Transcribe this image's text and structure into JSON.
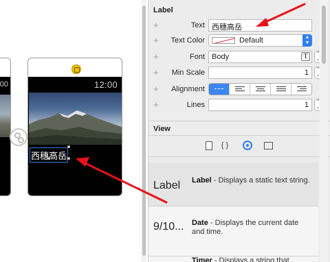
{
  "canvas": {
    "left_scene_time_fragment": "00",
    "main_scene": {
      "time": "12:00",
      "label_text": "西穗高岳"
    }
  },
  "inspector": {
    "label_section": {
      "title": "Label",
      "rows": {
        "text": {
          "label": "Text",
          "value": "西穗高岳"
        },
        "text_color": {
          "label": "Text Color",
          "value": "Default"
        },
        "font": {
          "label": "Font",
          "value": "Body"
        },
        "min_scale": {
          "label": "Min Scale",
          "value": "1"
        },
        "alignment": {
          "label": "Alignment"
        },
        "lines": {
          "label": "Lines",
          "value": "1"
        }
      }
    },
    "view_section": {
      "title": "View"
    },
    "library": [
      {
        "preview": "Label",
        "name": "Label",
        "description": " - Displays a static text string."
      },
      {
        "preview": "9/10...",
        "name": "Date",
        "description": " - Displays the current date and time."
      },
      {
        "preview": "",
        "name": "Timer",
        "description": " - Displays a string that"
      }
    ]
  },
  "colors": {
    "accent": "#3c86f1",
    "annotation_arrow": "#e8121b"
  },
  "icons": [
    "glance-icon",
    "segue-icon",
    "file-icon",
    "braces-icon",
    "target-icon",
    "film-icon",
    "t-icon",
    "chevron-updown-icon",
    "plus-icon"
  ]
}
